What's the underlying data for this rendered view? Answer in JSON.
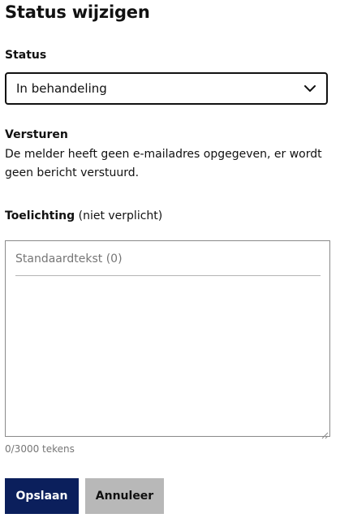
{
  "page": {
    "title": "Status wijzigen"
  },
  "status": {
    "label": "Status",
    "selected_value": "In behandeling"
  },
  "send": {
    "heading": "Versturen",
    "message": "De melder heeft geen e-mailadres opgegeven, er wordt geen bericht verstuurd."
  },
  "explanation": {
    "label": "Toelichting",
    "optional_hint": "(niet verplicht)",
    "standard_text_link": "Standaardtekst (0)",
    "value": "",
    "counter": "0/3000 tekens"
  },
  "actions": {
    "save_label": "Opslaan",
    "cancel_label": "Annuleer"
  },
  "colors": {
    "primary_button": "#0b1f5c",
    "secondary_button": "#b8b8b8",
    "muted_text": "#767676"
  },
  "icons": {
    "select_chevron": "chevron-down-icon",
    "textarea_resize": "resize-handle-icon"
  }
}
